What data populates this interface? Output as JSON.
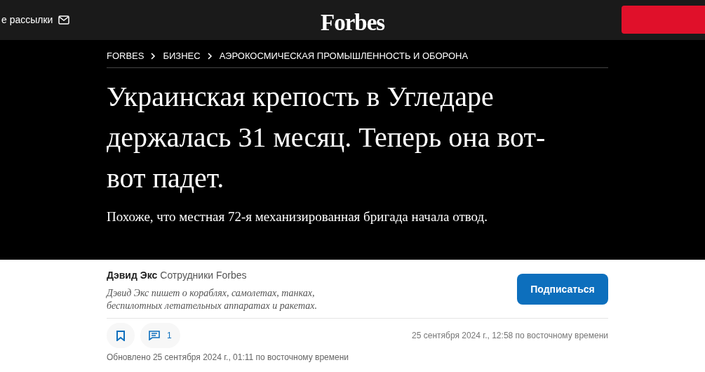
{
  "header": {
    "newsletter_link": "е рассылки",
    "logo": "Forbes"
  },
  "breadcrumbs": [
    {
      "label": "FORBES"
    },
    {
      "label": "БИЗНЕС"
    },
    {
      "label": "АЭРОКОСМИЧЕСКАЯ ПРОМЫШЛЕННОСТЬ И ОБОРОНА"
    }
  ],
  "headline": "Украинская крепость в Угледаре держалась 31 месяц. Теперь она вот-вот падет.",
  "subheadline": "Похоже, что местная 72-я механизированная бригада начала отвод.",
  "author": {
    "name": "Дэвид Экс",
    "role": "Сотрудники Forbes",
    "bio": "Дэвид Экс пишет о кораблях, самолетах, танках, беспилотных летательных аппаратах и ракетах.",
    "follow_button": "Подписаться"
  },
  "actions": {
    "comment_count": "1"
  },
  "published": "25 сентября 2024 г., 12:58 по восточному времени",
  "updated": "Обновлено 25 сентября 2024 г., 01:11 по восточному времени"
}
